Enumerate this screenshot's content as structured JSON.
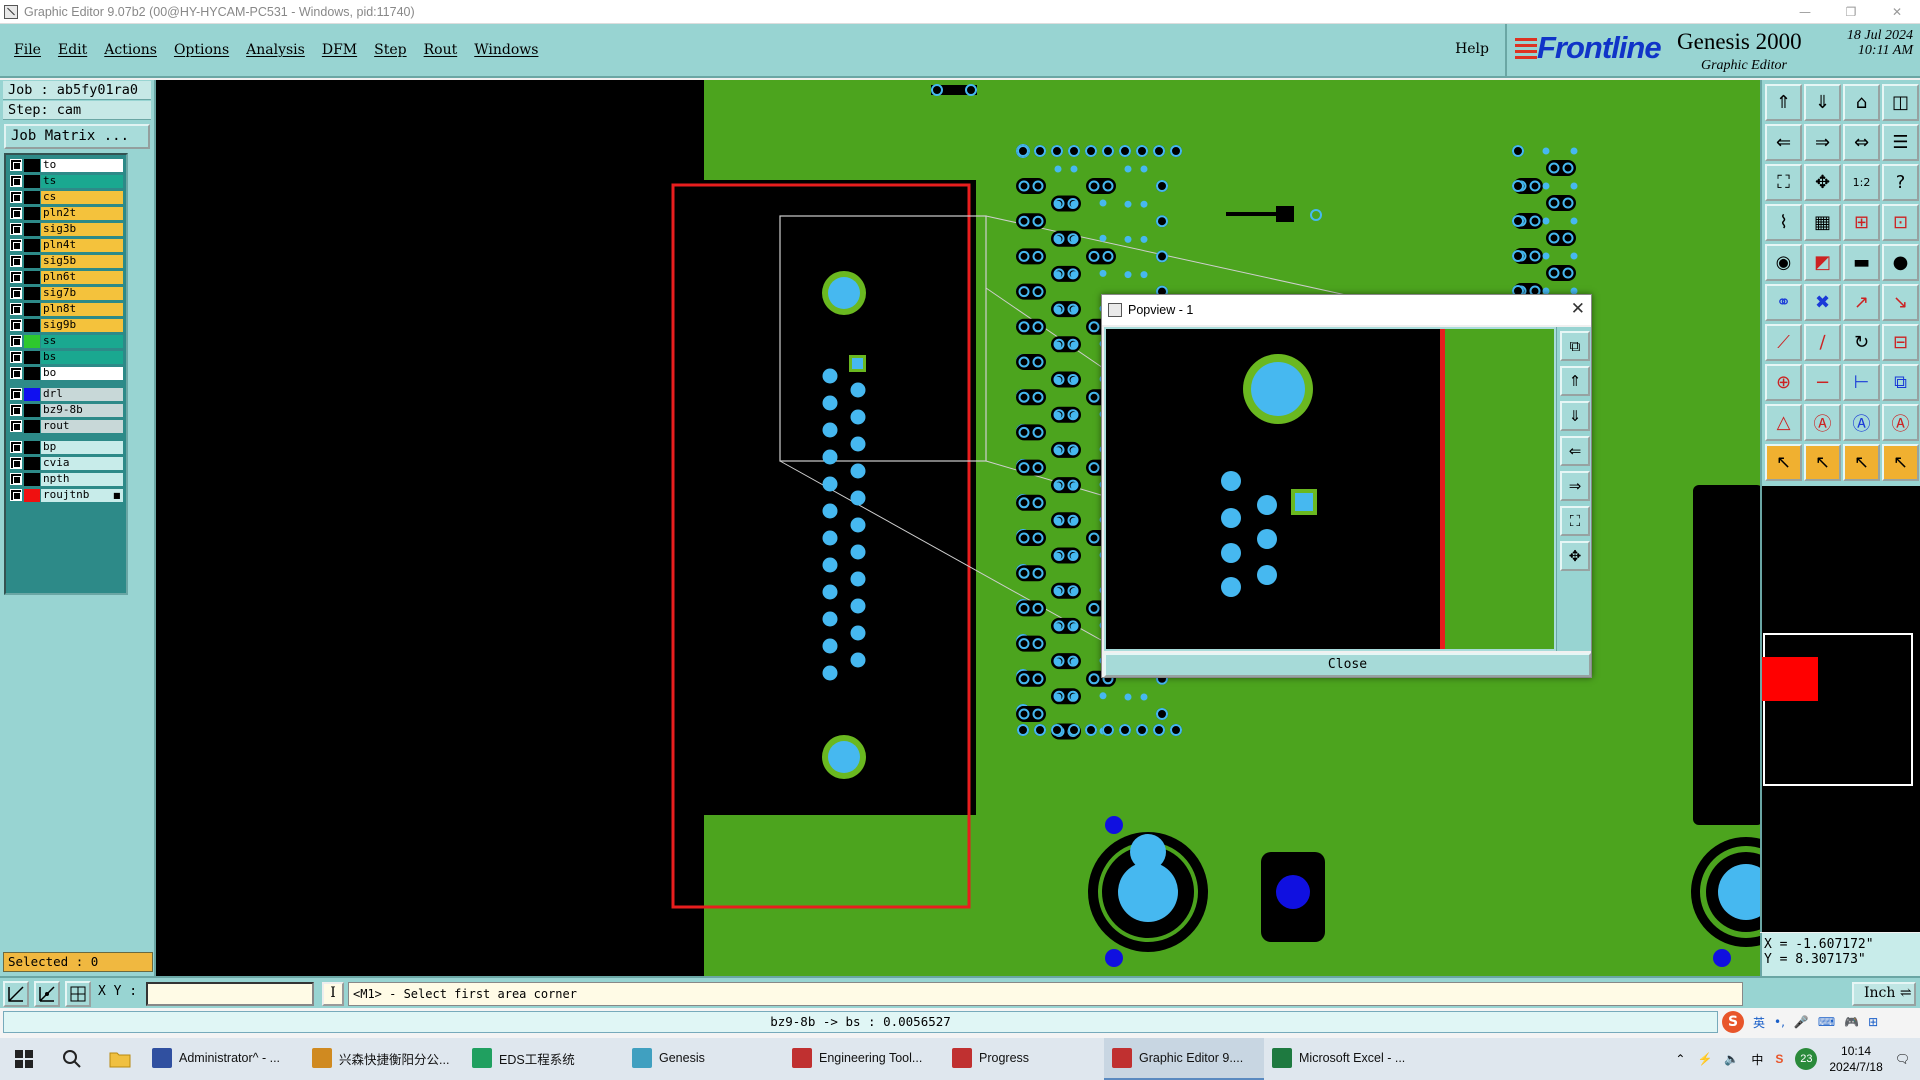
{
  "window": {
    "title": "Graphic Editor 9.07b2 (00@HY-HYCAM-PC531 - Windows, pid:11740)",
    "controls": [
      "—",
      "❐",
      "✕"
    ]
  },
  "menu": [
    "File",
    "Edit",
    "Actions",
    "Options",
    "Analysis",
    "DFM",
    "Step",
    "Rout",
    "Windows"
  ],
  "help_label": "Help",
  "logo": {
    "brand": "Frontline",
    "product": "Genesis 2000",
    "subtitle": "Graphic Editor",
    "date": "18 Jul 2024",
    "time": "10:11 AM"
  },
  "job_line": "Job : ab5fy01ra0",
  "step_line": "Step: cam",
  "job_matrix_label": "Job Matrix ...",
  "layers": [
    {
      "name": "to",
      "bg": "#ffffff",
      "swatch": "#000000"
    },
    {
      "name": "ts",
      "bg": "#1aa890",
      "swatch": "#000000"
    },
    {
      "name": "cs",
      "bg": "#f4c23c",
      "swatch": "#000000"
    },
    {
      "name": "pln2t",
      "bg": "#f4c23c",
      "swatch": "#000000"
    },
    {
      "name": "sig3b",
      "bg": "#f4c23c",
      "swatch": "#000000"
    },
    {
      "name": "pln4t",
      "bg": "#f4c23c",
      "swatch": "#000000"
    },
    {
      "name": "sig5b",
      "bg": "#f4c23c",
      "swatch": "#000000"
    },
    {
      "name": "pln6t",
      "bg": "#f4c23c",
      "swatch": "#000000"
    },
    {
      "name": "sig7b",
      "bg": "#f4c23c",
      "swatch": "#000000"
    },
    {
      "name": "pln8t",
      "bg": "#f4c23c",
      "swatch": "#000000"
    },
    {
      "name": "sig9b",
      "bg": "#f4c23c",
      "swatch": "#000000"
    },
    {
      "name": "ss",
      "bg": "#1aa890",
      "swatch": "#2ec82e"
    },
    {
      "name": "bs",
      "bg": "#1aa890",
      "swatch": "#000000"
    },
    {
      "name": "bo",
      "bg": "#ffffff",
      "swatch": "#000000"
    },
    {
      "name": "drl",
      "bg": "#c8d8d8",
      "swatch": "#1010f0",
      "gap": true
    },
    {
      "name": "bz9-8b",
      "bg": "#c8d8d8",
      "swatch": "#000000"
    },
    {
      "name": "rout",
      "bg": "#c8d8d8",
      "swatch": "#000000"
    },
    {
      "name": "bp",
      "bg": "#c8ecea",
      "swatch": "#000000",
      "gap": true
    },
    {
      "name": "cvia",
      "bg": "#c8ecea",
      "swatch": "#000000"
    },
    {
      "name": "npth",
      "bg": "#c8ecea",
      "swatch": "#000000"
    },
    {
      "name": "roujtnb",
      "bg": "#c8ecea",
      "swatch": "#f01010",
      "marker": "■"
    }
  ],
  "selected_label": "Selected : 0",
  "coords": {
    "x": "X = -1.607172\"",
    "y": "Y = 8.307173\""
  },
  "cmd": {
    "xy_label": "X Y :",
    "xy_value": "",
    "msg_icon": "I",
    "message": "<M1> - Select first area corner",
    "unit": "Inch ⇌"
  },
  "status_text": "bz9-8b -> bs : 0.0056527",
  "ime": {
    "brand": "S",
    "chars": [
      "英",
      "•,",
      "🎤",
      "⌨",
      "🎮",
      "⊞"
    ]
  },
  "popview": {
    "title": "Popview - 1",
    "close_label": "Close"
  },
  "taskbar": {
    "items": [
      {
        "label": "Administrator^ - ...",
        "color": "#3050a0"
      },
      {
        "label": "兴森快捷衡阳分公...",
        "color": "#d08a20"
      },
      {
        "label": "EDS工程系统",
        "color": "#20a060"
      },
      {
        "label": "Genesis",
        "color": "#40a0c0"
      },
      {
        "label": "Engineering Tool...",
        "color": "#c03030"
      },
      {
        "label": "Progress",
        "color": "#c03030"
      },
      {
        "label": "Graphic Editor 9....",
        "color": "#c03030",
        "active": true
      },
      {
        "label": "Microsoft Excel - ...",
        "color": "#1e7a40"
      }
    ],
    "tray": {
      "lang": "中",
      "badge": "23",
      "time": "10:14",
      "date": "2024/7/18"
    }
  },
  "colors": {
    "board": "#4ca41e",
    "pad": "#46b8f0",
    "pad_ring": "#6ab820",
    "outline": "#e81e1e",
    "via": "#1010e0"
  }
}
